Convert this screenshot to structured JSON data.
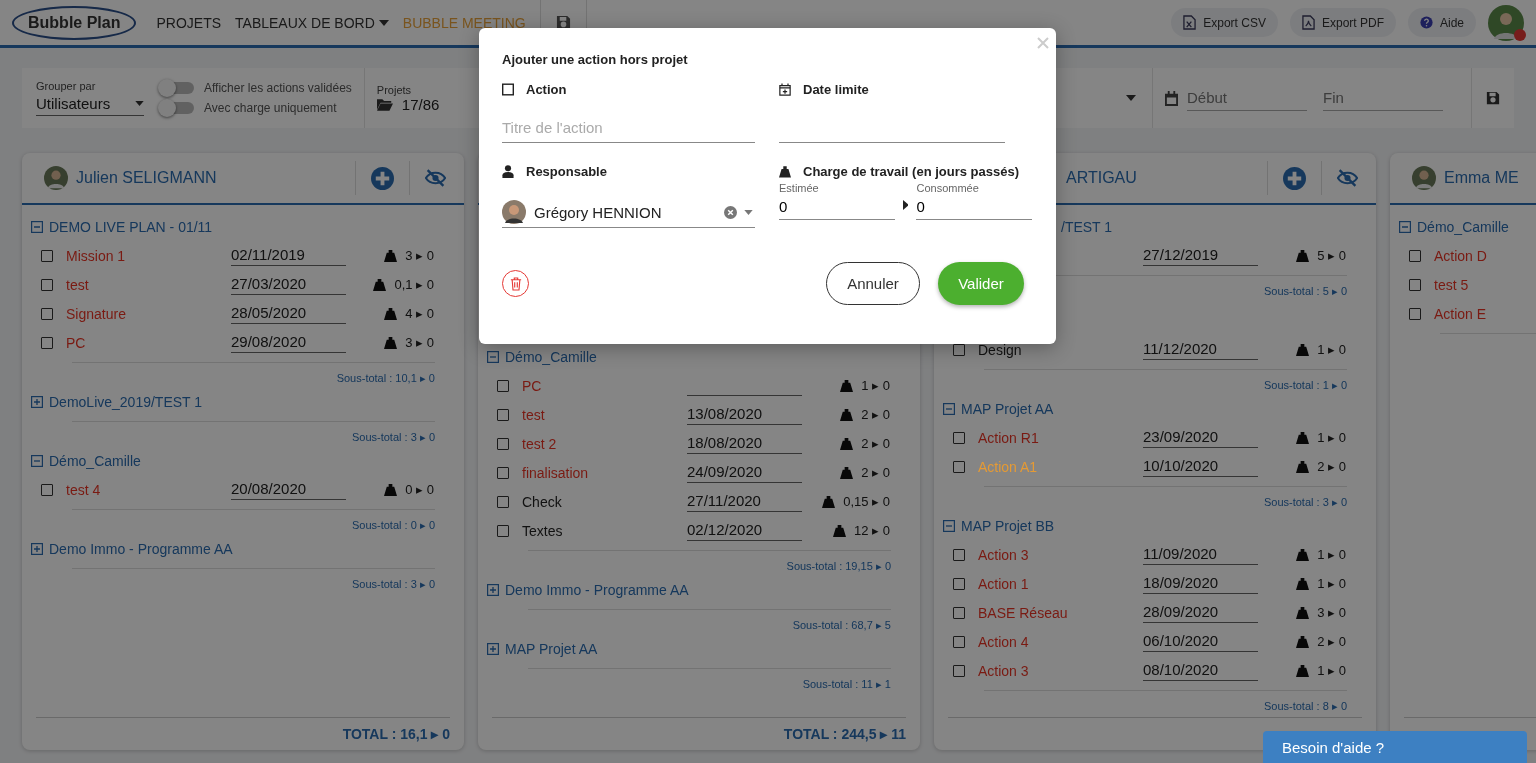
{
  "topbar": {
    "logo": "Bubble Plan",
    "nav": [
      {
        "label": "PROJETS",
        "selected": false,
        "dropdown": false
      },
      {
        "label": "TABLEAUX DE BORD",
        "selected": false,
        "dropdown": true
      },
      {
        "label": "BUBBLE MEETING",
        "selected": true,
        "dropdown": false
      }
    ],
    "buttons": [
      {
        "label": "Export CSV",
        "kind": "csv"
      },
      {
        "label": "Export PDF",
        "kind": "pdf"
      },
      {
        "label": "Aide",
        "kind": "help"
      }
    ],
    "notifications": true
  },
  "filters": {
    "group_by": {
      "label": "Grouper par",
      "value": "Utilisateurs"
    },
    "toggles": [
      {
        "label": "Afficher les actions validées",
        "on": false
      },
      {
        "label": "Avec charge uniquement",
        "on": false
      }
    ],
    "projects": {
      "label": "Projets",
      "value": "17/86"
    },
    "start": {
      "placeholder": "Début"
    },
    "end": {
      "placeholder": "Fin"
    }
  },
  "columns": [
    {
      "header": {
        "name": "Julien SELIGMANN"
      },
      "groups": [
        {
          "name": "DEMO LIVE PLAN - 01/11",
          "expanded": true,
          "rows": [
            {
              "name": "Mission 1",
              "checked": false,
              "color": "#7a1a12",
              "date": "02/11/2019",
              "load": "3 ▸ 0"
            },
            {
              "name": "test",
              "checked": false,
              "color": "#7a1a12",
              "date": "27/03/2020",
              "load": "0,1 ▸ 0"
            },
            {
              "name": "Signature",
              "checked": false,
              "color": "#7a1a12",
              "date": "28/05/2020",
              "load": "4 ▸ 0"
            },
            {
              "name": "PC",
              "checked": false,
              "color": "#7a1a12",
              "date": "29/08/2020",
              "load": "3 ▸ 0"
            }
          ],
          "subtotal": "Sous-total : 10,1 ▸ 0"
        },
        {
          "name": "DemoLive_2019/TEST 1",
          "expanded": false,
          "subtotal": "Sous-total : 3 ▸ 0"
        },
        {
          "name": "Démo_Camille",
          "expanded": true,
          "rows": [
            {
              "name": "test 4",
              "checked": false,
              "color": "#7a1a12",
              "date": "20/08/2020",
              "load": "0 ▸ 0"
            }
          ],
          "subtotal": "Sous-total : 0 ▸ 0"
        },
        {
          "name": "Demo Immo - Programme AA",
          "expanded": false,
          "subtotal": "Sous-total : 3 ▸ 0"
        }
      ],
      "total": "TOTAL : 16,1 ▸ 0"
    },
    {
      "groups": [
        {
          "name": "Démo_Camille",
          "expanded": true,
          "rows": [
            {
              "name": "PC",
              "checked": false,
              "color": "#7a1a12",
              "load": "1 ▸ 0"
            },
            {
              "name": "test",
              "checked": false,
              "color": "#7a1a12",
              "date": "13/08/2020",
              "load": "2 ▸ 0"
            },
            {
              "name": "test 2",
              "checked": false,
              "color": "#7a1a12",
              "date": "18/08/2020",
              "load": "2 ▸ 0"
            },
            {
              "name": "finalisation",
              "checked": false,
              "color": "#7a1a12",
              "date": "24/09/2020",
              "load": "2 ▸ 0"
            },
            {
              "name": "Check",
              "checked": false,
              "color": "#111111",
              "date": "27/11/2020",
              "load": "0,15 ▸ 0"
            },
            {
              "name": "Textes",
              "checked": false,
              "color": "#111111",
              "date": "02/12/2020",
              "load": "12 ▸ 0"
            }
          ],
          "subtotal": "Sous-total : 19,15 ▸ 0"
        },
        {
          "name": "Demo Immo - Programme AA",
          "expanded": false,
          "subtotal": "Sous-total : 68,7 ▸ 5"
        },
        {
          "name": "MAP Projet AA",
          "expanded": false,
          "subtotal": "Sous-total : 11 ▸ 1"
        }
      ],
      "total": "TOTAL : 244,5 ▸ 11"
    },
    {
      "header": {
        "name": "ARTIGAU"
      },
      "groups": [
        {
          "name": "/TEST 1",
          "rows": [
            {
              "date": "27/12/2019",
              "load": "5 ▸ 0"
            }
          ],
          "subtotal": "Sous-total : 5 ▸ 0"
        },
        {
          "rows": [
            {
              "name": "Design",
              "checked": false,
              "color": "#111111",
              "date": "11/12/2020",
              "load": "1 ▸ 0"
            }
          ],
          "subtotal": "Sous-total : 1 ▸ 0"
        },
        {
          "name": "MAP Projet AA",
          "expanded": true,
          "rows": [
            {
              "name": "Action R1",
              "checked": false,
              "color": "#7a1a12",
              "date": "23/09/2020",
              "load": "1 ▸ 0"
            },
            {
              "name": "Action A1",
              "checked": false,
              "color": "#e59a34",
              "date": "10/10/2020",
              "load": "2 ▸ 0"
            }
          ],
          "subtotal": "Sous-total : 3 ▸ 0"
        },
        {
          "name": "MAP Projet BB",
          "expanded": true,
          "rows": [
            {
              "name": "Action 3",
              "checked": false,
              "color": "#7a1a12",
              "date": "11/09/2020",
              "load": "1 ▸ 0"
            },
            {
              "name": "Action 1",
              "checked": false,
              "color": "#7a1a12",
              "date": "18/09/2020",
              "load": "1 ▸ 0"
            },
            {
              "name": "BASE Réseau",
              "checked": false,
              "color": "#7a1a12",
              "date": "28/09/2020",
              "load": "3 ▸ 0"
            },
            {
              "name": "Action 4",
              "checked": false,
              "color": "#7a1a12",
              "date": "06/10/2020",
              "load": "2 ▸ 0"
            },
            {
              "name": "Action 3",
              "checked": false,
              "color": "#7a1a12",
              "date": "08/10/2020",
              "load": "1 ▸ 0"
            }
          ],
          "subtotal": "Sous-total : 8 ▸ 0"
        }
      ]
    },
    {
      "header": {
        "name": "Emma ME"
      },
      "groups": [
        {
          "name": "Démo_Camille",
          "expanded": true,
          "rows": [
            {
              "name": "Action D",
              "checked": false,
              "color": "#7a1a12"
            },
            {
              "name": "test 5",
              "checked": false,
              "color": "#7a1a12"
            },
            {
              "name": "Action E",
              "checked": false,
              "color": "#7a1a12"
            }
          ]
        }
      ]
    }
  ],
  "dialog": {
    "title": "Ajouter une action hors projet",
    "action": {
      "label": "Action",
      "placeholder": "Titre de l'action"
    },
    "deadline": {
      "label": "Date limite"
    },
    "owner": {
      "label": "Responsable",
      "value": "Grégory HENNION"
    },
    "workload": {
      "label": "Charge de travail (en jours passés)",
      "estimate_label": "Estimée",
      "estimate": "0",
      "spent_label": "Consommée",
      "spent": "0"
    },
    "buttons": {
      "cancel": "Annuler",
      "confirm": "Valider"
    }
  },
  "help_tab": "Besoin d'aide ?"
}
